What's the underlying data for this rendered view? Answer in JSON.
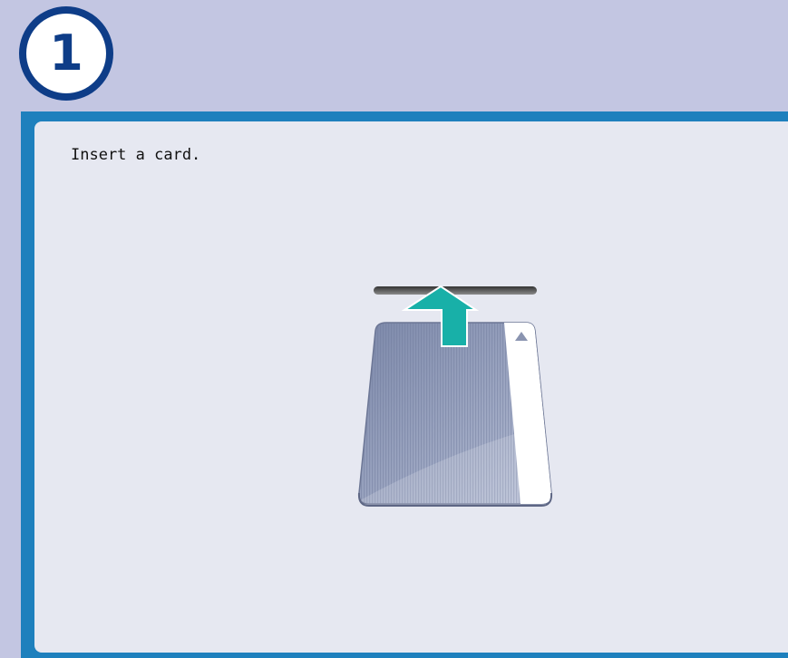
{
  "step": {
    "number": "1"
  },
  "panel": {
    "instruction": "Insert a card."
  },
  "illustration": {
    "icon": "card-insert-icon",
    "arrow_color": "#18b0a8",
    "card_color": "#8f9bb9",
    "stripe_color": "#ffffff"
  }
}
